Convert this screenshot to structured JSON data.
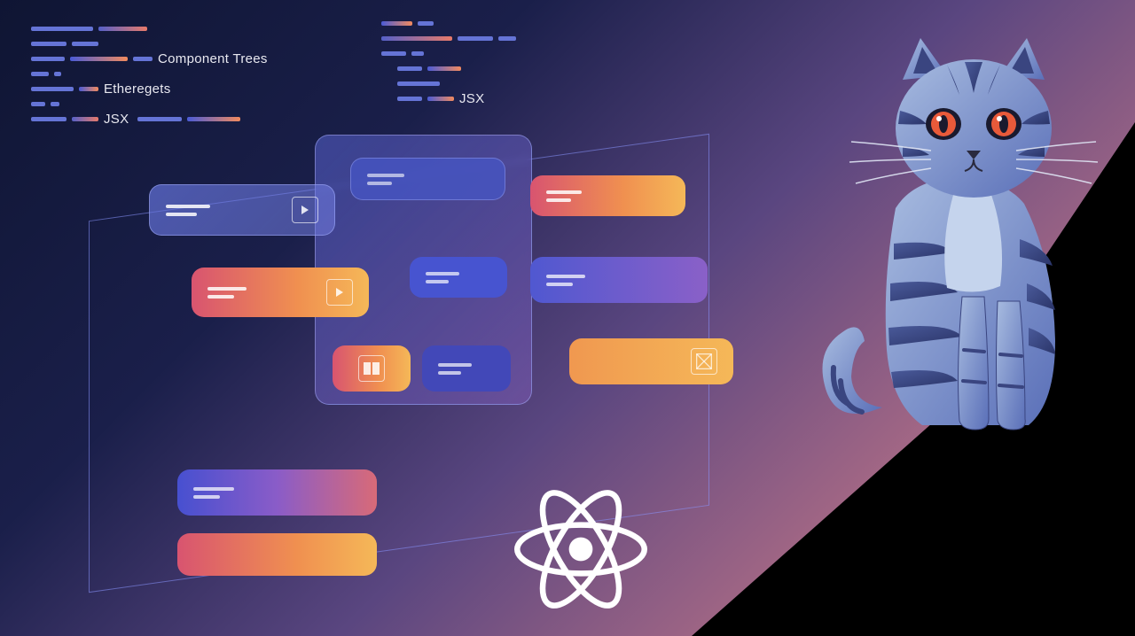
{
  "labels": {
    "group1": {
      "line1": "Component Trees",
      "line2": "Etheregets",
      "line3": "JSX"
    },
    "group2": {
      "line1": "JSX"
    }
  },
  "logo": "react",
  "illustration": "cat"
}
